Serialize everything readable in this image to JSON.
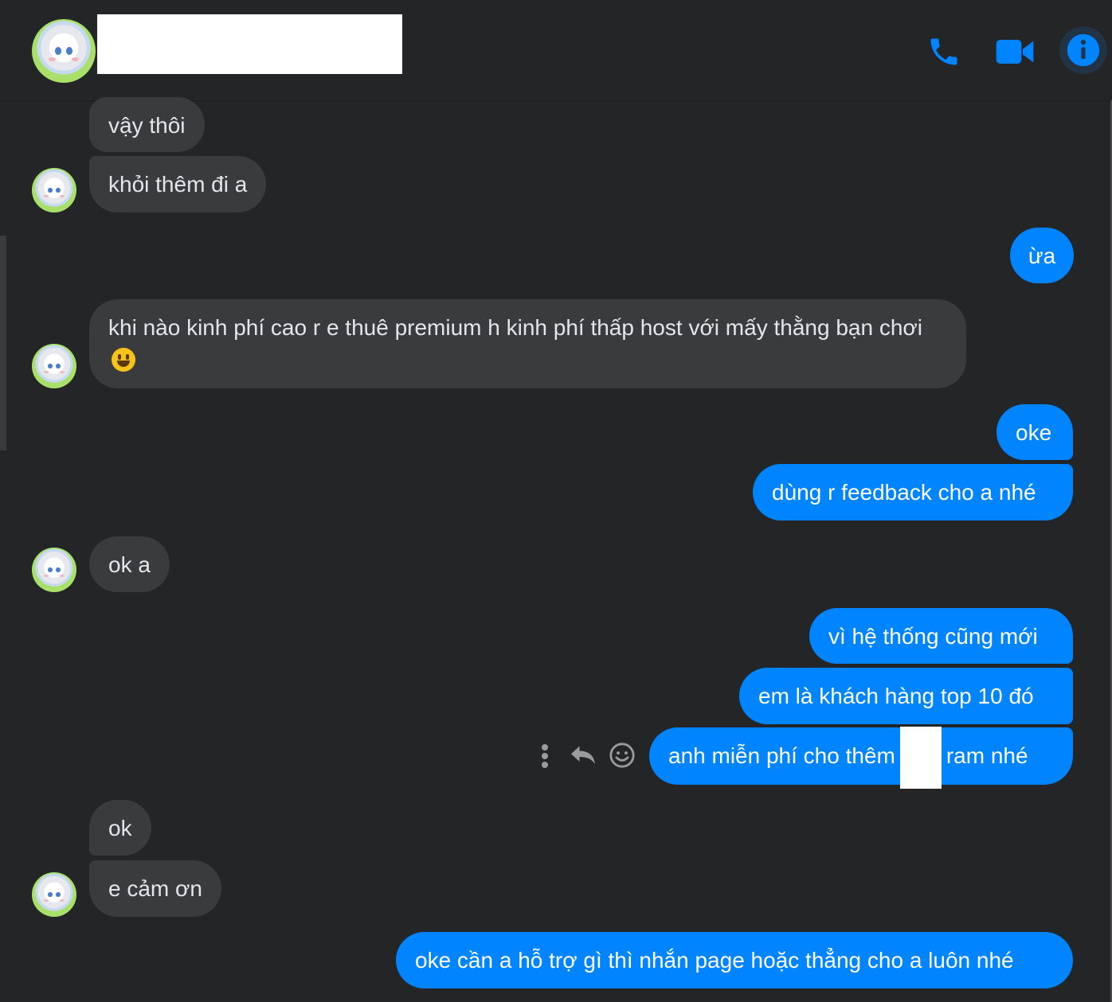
{
  "header": {
    "contact_name": "",
    "icons": [
      "phone-icon",
      "video-camera-icon",
      "info-icon"
    ],
    "accent_color": "#0084ff"
  },
  "messages": [
    {
      "side": "incoming",
      "text": "vậy thôi"
    },
    {
      "side": "incoming",
      "text": "khỏi thêm đi a"
    },
    {
      "side": "outgoing",
      "text": "ừa"
    },
    {
      "side": "incoming",
      "text": "khi nào kinh phí cao r e thuê premium h kinh phí thấp host với mấy thằng bạn chơi",
      "emoji": "grinning-face"
    },
    {
      "side": "outgoing",
      "text": "oke"
    },
    {
      "side": "outgoing",
      "text": "dùng r feedback cho a nhé"
    },
    {
      "side": "incoming",
      "text": "ok a"
    },
    {
      "side": "outgoing",
      "text": "vì hệ thống cũng mới"
    },
    {
      "side": "outgoing",
      "text": "em là khách hàng top 10 đó"
    },
    {
      "side": "outgoing",
      "text_before": "anh miễn phí cho thêm",
      "text_after": "ram nhé"
    },
    {
      "side": "incoming",
      "text": "ok"
    },
    {
      "side": "incoming",
      "text": "e cảm ơn"
    },
    {
      "side": "outgoing",
      "text": "oke cần a hỗ trợ gì thì nhắn page hoặc thẳng cho a luôn nhé"
    }
  ],
  "message_actions": [
    "more-options-icon",
    "reply-icon",
    "react-icon"
  ],
  "colors": {
    "background": "#242526",
    "incoming_bubble": "#3a3b3c",
    "outgoing_bubble": "#0084ff"
  }
}
